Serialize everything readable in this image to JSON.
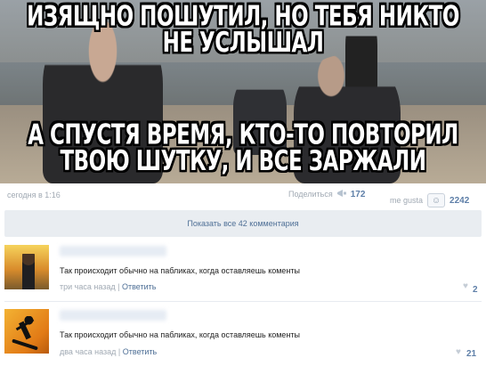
{
  "meme": {
    "caption_top_line1": "ИЗЯЩНО ПОШУТИЛ, НО ТЕБЯ НИКТО",
    "caption_top_line2": "НЕ УСЛЫШАЛ",
    "caption_bottom_line1": "А СПУСТЯ ВРЕМЯ, КТО-ТО ПОВТОРИЛ",
    "caption_bottom_line2": "ТВОЮ ШУТКУ, И ВСЕ ЗАРЖАЛИ"
  },
  "post": {
    "timestamp": "сегодня в 1:16",
    "share_label": "Поделиться",
    "share_count": "172",
    "like_label": "me gusta",
    "like_count": "2242",
    "show_all_label": "Показать все 42 комментария"
  },
  "comments": [
    {
      "text": "Так происходит обычно на пабликах, когда оставляешь коменты",
      "time": "три часа назад",
      "separator": "|",
      "reply_label": "Ответить",
      "likes": "2"
    },
    {
      "text": "Так происходит обычно на пабликах, когда оставляешь коменты",
      "time": "два часа назад",
      "separator": "|",
      "reply_label": "Ответить",
      "likes": "21"
    }
  ],
  "icons": {
    "share": "megaphone-icon",
    "like": "smiley-icon",
    "comment_like": "heart-icon"
  },
  "colors": {
    "link": "#4e6f96",
    "count": "#5e7fa8",
    "muted": "#a0a9b3",
    "show_all_bg": "#e9edf1"
  }
}
